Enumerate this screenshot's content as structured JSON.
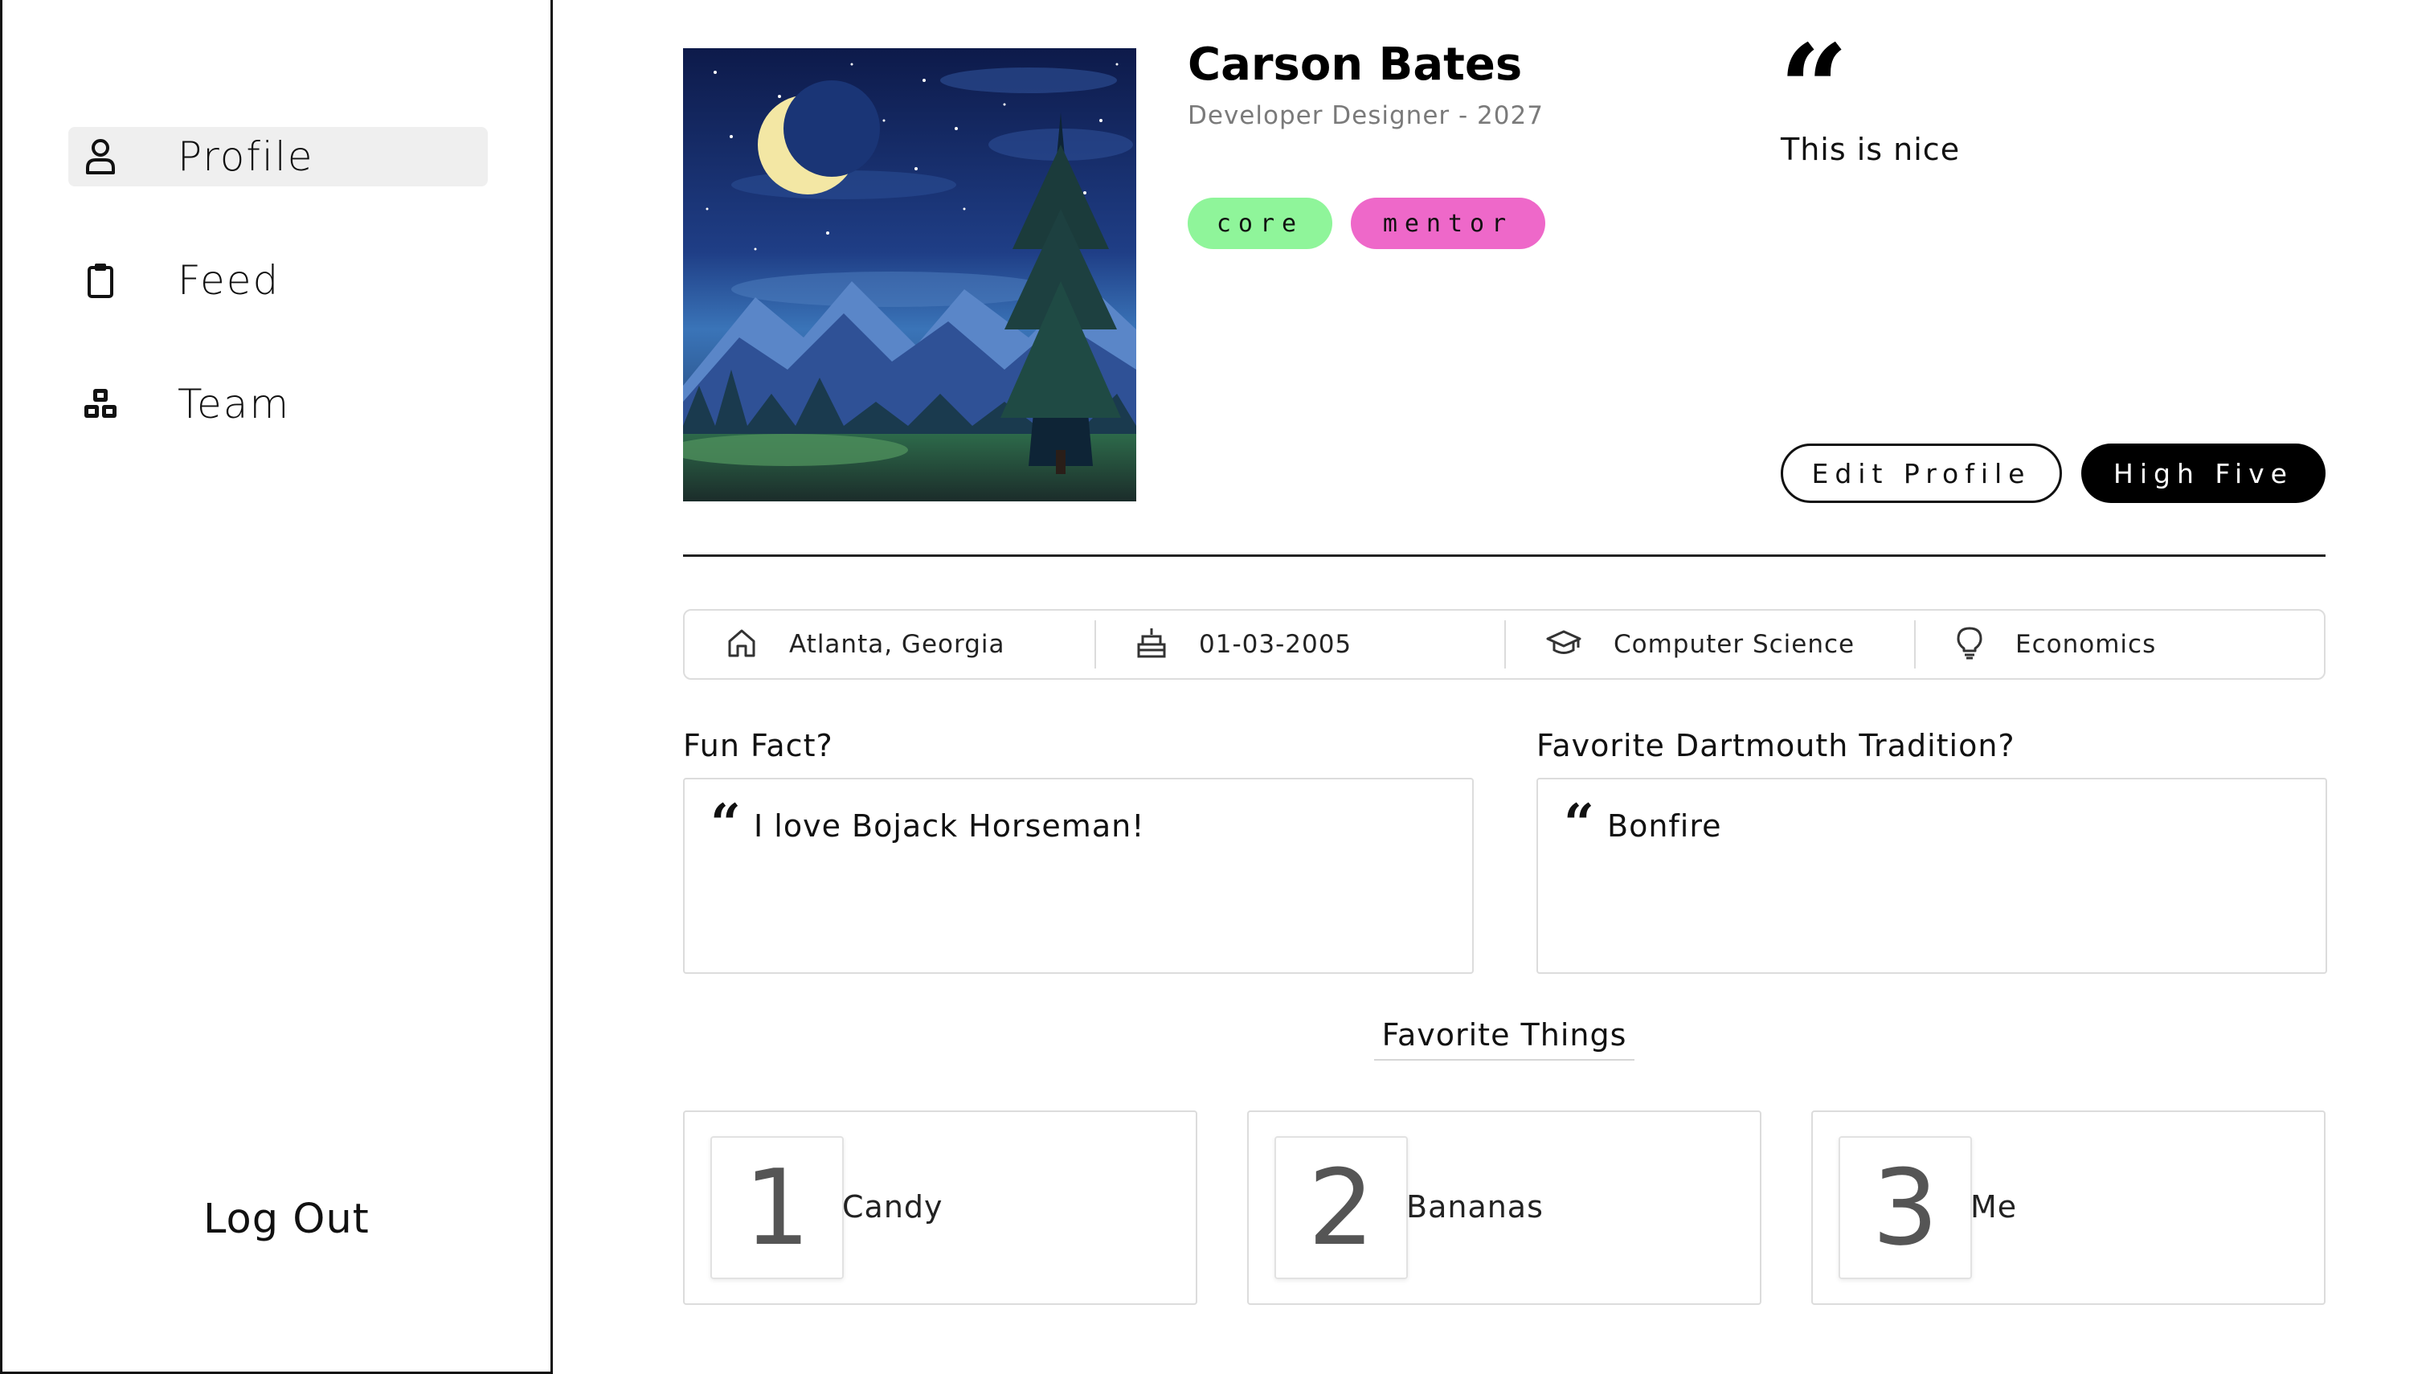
{
  "sidebar": {
    "items": [
      {
        "label": "Profile",
        "icon": "user-icon",
        "active": true
      },
      {
        "label": "Feed",
        "icon": "clipboard-icon",
        "active": false
      },
      {
        "label": "Team",
        "icon": "team-cubes-icon",
        "active": false
      }
    ],
    "logout_label": "Log Out"
  },
  "profile": {
    "name": "Carson Bates",
    "subtitle": "Developer Designer - 2027",
    "tags": [
      {
        "label": "core",
        "color": "#8ff59a"
      },
      {
        "label": "mentor",
        "color": "#ee68c9"
      }
    ],
    "quote": "This is nice",
    "avatar_icon": "night-landscape-image"
  },
  "actions": {
    "edit_label": "Edit Profile",
    "high_five_label": "High Five"
  },
  "info": [
    {
      "icon": "home-icon",
      "label": "Atlanta, Georgia"
    },
    {
      "icon": "birthday-cake-icon",
      "label": "01-03-2005"
    },
    {
      "icon": "graduation-cap-icon",
      "label": "Computer Science"
    },
    {
      "icon": "lightbulb-icon",
      "label": "Economics"
    }
  ],
  "qa": [
    {
      "question": "Fun Fact?",
      "answer": "I love Bojack Horseman!"
    },
    {
      "question": "Favorite Dartmouth Tradition?",
      "answer": "Bonfire"
    }
  ],
  "favorites": {
    "title": "Favorite Things",
    "items": [
      {
        "rank": "1",
        "label": "Candy"
      },
      {
        "rank": "2",
        "label": "Bananas"
      },
      {
        "rank": "3",
        "label": "Me"
      }
    ]
  }
}
